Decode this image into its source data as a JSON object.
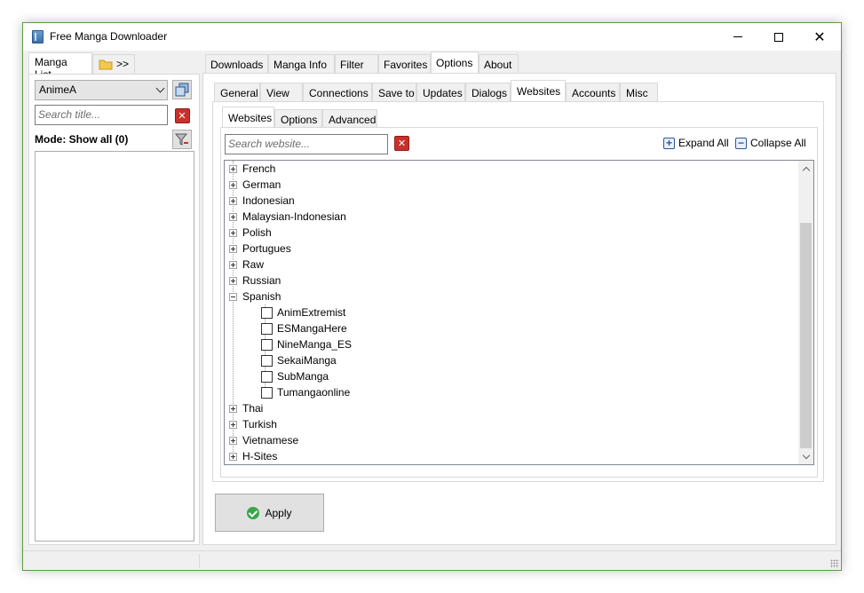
{
  "window": {
    "title": "Free Manga Downloader"
  },
  "left": {
    "tabs": [
      {
        "label": "Manga List"
      },
      {
        "label": ">>"
      }
    ],
    "source_select": "AnimeA",
    "search_placeholder": "Search title...",
    "mode_label": "Mode: Show all (0)"
  },
  "main_tabs": [
    {
      "label": "Downloads"
    },
    {
      "label": "Manga Info"
    },
    {
      "label": "Filter"
    },
    {
      "label": "Favorites"
    },
    {
      "label": "Options"
    },
    {
      "label": "About"
    }
  ],
  "options_tabs": [
    {
      "label": "General"
    },
    {
      "label": "View"
    },
    {
      "label": "Connections"
    },
    {
      "label": "Save to"
    },
    {
      "label": "Updates"
    },
    {
      "label": "Dialogs"
    },
    {
      "label": "Websites"
    },
    {
      "label": "Accounts"
    },
    {
      "label": "Misc"
    }
  ],
  "websites_tabs": [
    {
      "label": "Websites"
    },
    {
      "label": "Options"
    },
    {
      "label": "Advanced"
    }
  ],
  "website_search_placeholder": "Search website...",
  "expand_all": "Expand All",
  "collapse_all": "Collapse All",
  "tree": {
    "groups_before": [
      "French",
      "German",
      "Indonesian",
      "Malaysian-Indonesian",
      "Polish",
      "Portugues",
      "Raw",
      "Russian"
    ],
    "expanded_group": "Spanish",
    "expanded_children": [
      "AnimExtremist",
      "ESMangaHere",
      "NineManga_ES",
      "SekaiManga",
      "SubManga",
      "Tumangaonline"
    ],
    "groups_after": [
      "Thai",
      "Turkish",
      "Vietnamese",
      "H-Sites"
    ]
  },
  "apply_label": "Apply"
}
